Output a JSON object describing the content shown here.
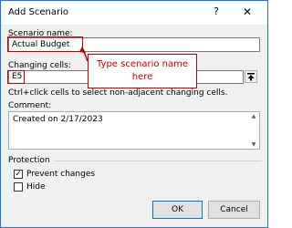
{
  "dialog": {
    "title": "Add Scenario",
    "help": "?",
    "close": "✕"
  },
  "scenario_name": {
    "label": "Scenario name:",
    "value": "Actual Budget"
  },
  "changing_cells": {
    "label": "Changing cells:",
    "value": "E5",
    "hint": "Ctrl+click cells to select non-adjacent changing cells."
  },
  "comment": {
    "label": "Comment:",
    "value": "Created on 2/17/2023"
  },
  "protection": {
    "label": "Protection",
    "prevent_changes": "Prevent changes",
    "prevent_checked": true,
    "hide": "Hide",
    "hide_checked": false
  },
  "buttons": {
    "ok": "OK",
    "cancel": "Cancel"
  },
  "annotation": {
    "text": "Type scenario name here",
    "color": "#c00000"
  }
}
